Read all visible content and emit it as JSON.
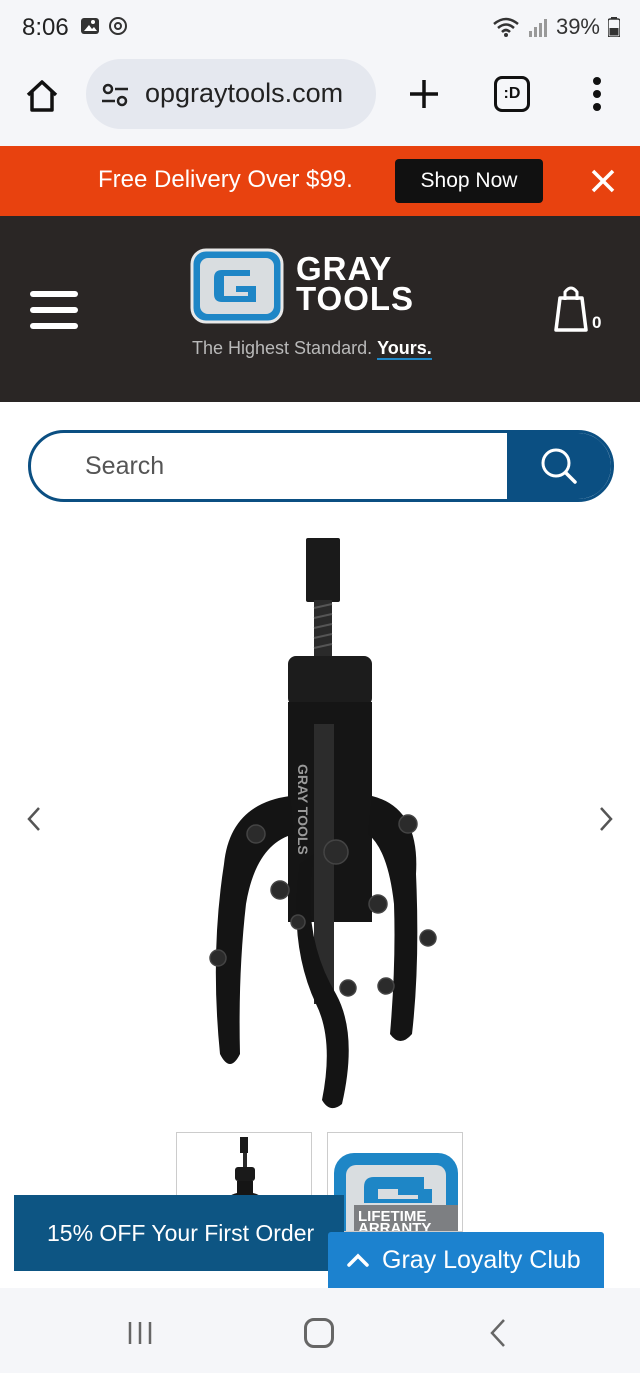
{
  "status_bar": {
    "time": "8:06",
    "battery": "39%"
  },
  "browser": {
    "url": "opgraytools.com",
    "tabs_label": ":D"
  },
  "promo": {
    "text": "Free Delivery Over $99.",
    "button": "Shop Now"
  },
  "header": {
    "logo_line1": "GRAY",
    "logo_line2": "TOOLS",
    "tagline": "The Highest Standard.",
    "tagline_strong": "Yours.",
    "cart_count": "0"
  },
  "search": {
    "placeholder": "Search"
  },
  "product": {
    "image_text": "GRAY TOOLS",
    "thumb2_line1": "LIFETIME",
    "thumb2_line2": "ARRANTY"
  },
  "discount": {
    "text": "15% OFF Your First Order"
  },
  "loyalty": {
    "text": "Gray Loyalty Club"
  },
  "colors": {
    "promo": "#e8420f",
    "header": "#2a2625",
    "brand_blue": "#0b4f82",
    "loyalty_blue": "#1c82cf"
  }
}
